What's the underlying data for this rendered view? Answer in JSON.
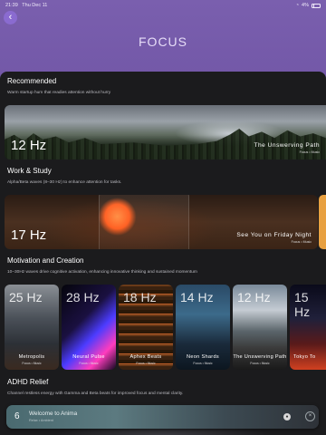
{
  "status": {
    "time": "21:39",
    "date": "Thu Dec 11",
    "battery": "4%"
  },
  "header": {
    "title": "FOCUS",
    "back_icon": "chevron-left-icon"
  },
  "sections": [
    {
      "title": "Recommended",
      "subtitle": "Warm startup hum that readies attention without hurry",
      "card": {
        "hz": "12 Hz",
        "name": "The Unswerving Path",
        "tags": "Focus • Music"
      }
    },
    {
      "title": "Work & Study",
      "subtitle": "Alpha/Beta waves (8–30 Hz) to enhance attention for tasks.",
      "card": {
        "hz": "17 Hz",
        "name": "See You on Friday Night",
        "tags": "Focus • Music"
      }
    },
    {
      "title": "Motivation and Creation",
      "subtitle": "10–30Hz waves drive cognitive activation, enhancing innovative thinking and sustained momentum",
      "tiles": [
        {
          "hz": "25 Hz",
          "name": "Metropolis",
          "tags": "Focus • Music"
        },
        {
          "hz": "28 Hz",
          "name": "Neural Pulse",
          "tags": "Focus • Music"
        },
        {
          "hz": "18 Hz",
          "name": "Aphex Beats",
          "tags": "Focus • Music"
        },
        {
          "hz": "14 Hz",
          "name": "Neon Shards",
          "tags": "Focus • Music"
        },
        {
          "hz": "12 Hz",
          "name": "The Unswerving Path",
          "tags": "Focus • Music"
        },
        {
          "hz": "15 Hz",
          "name": "Tokyo To",
          "tags": "Focus • Music"
        }
      ]
    },
    {
      "title": "ADHD Relief",
      "subtitle": "Channel restless energy with Gamma and Beta beats for improved focus and mental clarity."
    }
  ],
  "player": {
    "hz": "6",
    "title": "Welcome to Anima",
    "subtitle": "Relax • Ambient",
    "eq_icon": "equalizer-icon",
    "close_icon": "close-icon"
  }
}
